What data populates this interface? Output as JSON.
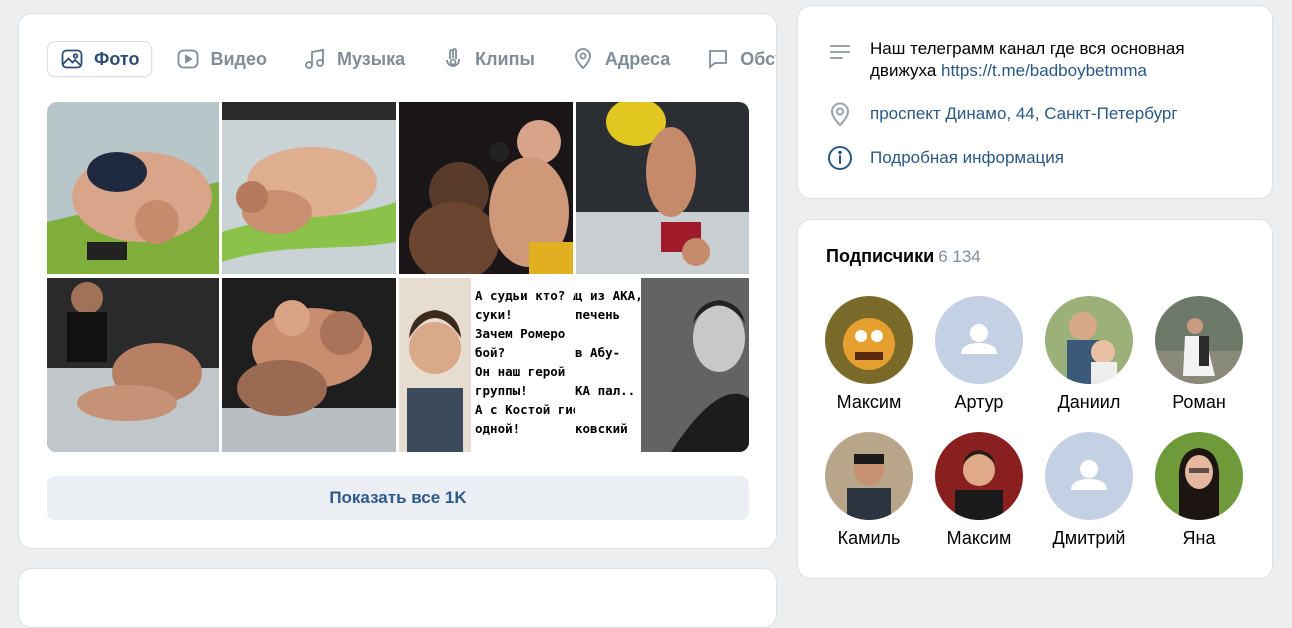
{
  "media": {
    "tabs": [
      {
        "label": "Фото",
        "icon": "image-icon",
        "active": true
      },
      {
        "label": "Видео",
        "icon": "video-icon",
        "active": false
      },
      {
        "label": "Музыка",
        "icon": "music-icon",
        "active": false
      },
      {
        "label": "Клипы",
        "icon": "clips-icon",
        "active": false
      },
      {
        "label": "Адреса",
        "icon": "location-icon",
        "active": false
      },
      {
        "label": "Обсуждения",
        "icon": "discussion-icon",
        "active": false
      }
    ],
    "meme_text_left": [
      "А судьи кто? А",
      "суки!",
      "Зачем Ромеро",
      "бой?",
      "Он наш герой",
      "группы!",
      "А с Костой гиф",
      "одной!"
    ],
    "meme_text_right": [
      "ц из АКА,",
      "печень",
      "в Абу-",
      "КА пал..",
      "ковский"
    ],
    "show_all_label": "Показать все 1K"
  },
  "info": {
    "description": "Наш телеграмм канал где вся основная движуха ",
    "description_link": "https://t.me/badboybetmma",
    "address": "проспект Динамо, 44, Санкт-Петербург",
    "details_label": "Подробная информация"
  },
  "subscribers": {
    "title": "Подписчики",
    "count": "6 134",
    "people": [
      {
        "name": "Максим"
      },
      {
        "name": "Артур"
      },
      {
        "name": "Даниил"
      },
      {
        "name": "Роман"
      },
      {
        "name": "Камиль"
      },
      {
        "name": "Максим"
      },
      {
        "name": "Дмитрий"
      },
      {
        "name": "Яна"
      }
    ]
  },
  "colors": {
    "accent": "#2a5885",
    "muted": "#818c99",
    "placeholder_avatar": "#c4d0e3"
  }
}
